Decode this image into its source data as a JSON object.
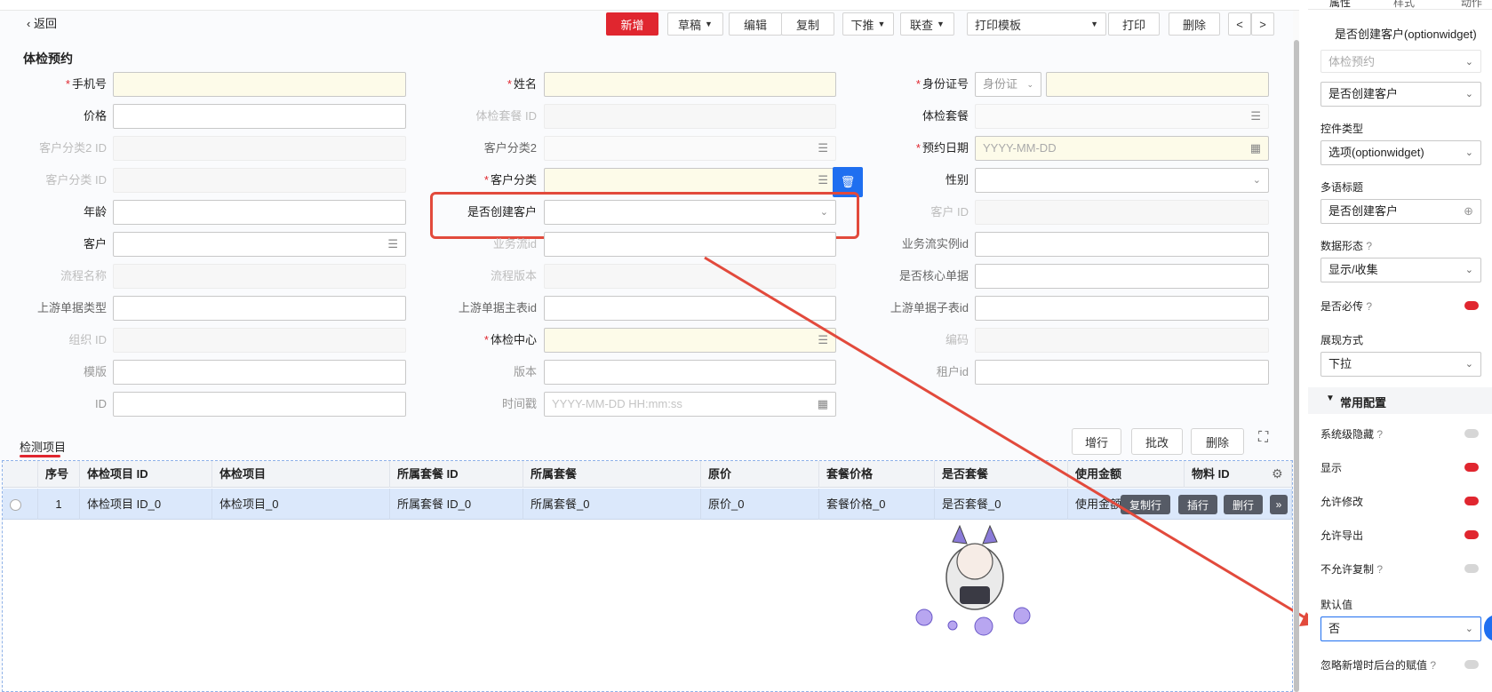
{
  "toolbar": {
    "back": "返回",
    "add": "新增",
    "draft": "草稿",
    "edit": "编辑",
    "copy": "复制",
    "push": "下推",
    "link": "联查",
    "print_template": "打印模板",
    "print": "打印",
    "delete": "删除",
    "prev": "<",
    "next": ">"
  },
  "form": {
    "title": "体检预约",
    "phone_label": "手机号",
    "name_label": "姓名",
    "idcard_label": "身份证号",
    "idcard_type": "身份证",
    "price_label": "价格",
    "pkg_id_label": "体检套餐 ID",
    "pkg_label": "体检套餐",
    "cust_cat2_id_label": "客户分类2 ID",
    "cust_cat2_label": "客户分类2",
    "appt_date_label": "预约日期",
    "appt_date_placeholder": "YYYY-MM-DD",
    "cust_cat_id_label": "客户分类 ID",
    "cust_cat_label": "客户分类",
    "gender_label": "性别",
    "age_label": "年龄",
    "create_cust_label": "是否创建客户",
    "cust_id_label": "客户 ID",
    "cust_label": "客户",
    "flow_id_label": "业务流id",
    "flow_inst_label": "业务流实例id",
    "proc_name_label": "流程名称",
    "proc_ver_label": "流程版本",
    "core_doc_label": "是否核心单据",
    "up_type_label": "上游单据类型",
    "up_main_label": "上游单据主表id",
    "up_sub_label": "上游单据子表id",
    "org_id_label": "组织 ID",
    "center_label": "体检中心",
    "code_label": "编码",
    "template_label": "模版",
    "version_label": "版本",
    "tenant_label": "租户id",
    "id_label": "ID",
    "timestamp_label": "时间戳",
    "timestamp_placeholder": "YYYY-MM-DD HH:mm:ss"
  },
  "subtable": {
    "tab": "检测项目",
    "add_row": "增行",
    "batch": "批改",
    "delete": "删除",
    "columns": [
      "序号",
      "体检项目 ID",
      "体检项目",
      "所属套餐 ID",
      "所属套餐",
      "原价",
      "套餐价格",
      "是否套餐",
      "使用金额",
      "物料 ID"
    ],
    "rows": [
      [
        "1",
        "体检项目 ID_0",
        "体检项目_0",
        "所属套餐 ID_0",
        "所属套餐_0",
        "原价_0",
        "套餐价格_0",
        "是否套餐_0",
        "使用金额"
      ]
    ],
    "row_actions": [
      "复制行",
      "插行",
      "删行"
    ]
  },
  "panel": {
    "tabs": [
      "属性",
      "样式",
      "动作"
    ],
    "field_title": "是否创建客户(optionwidget)",
    "entity": "体检预约",
    "field_select": "是否创建客户",
    "widget_type_label": "控件类型",
    "widget_type": "选项(optionwidget)",
    "i18n_label": "多语标题",
    "i18n_value": "是否创建客户",
    "data_form_label": "数据形态",
    "data_form": "显示/收集",
    "required_label": "是否必传",
    "display_label": "展现方式",
    "display_value": "下拉",
    "common_config": "常用配置",
    "sys_hidden_label": "系统级隐藏",
    "show_label": "显示",
    "allow_edit_label": "允许修改",
    "allow_export_label": "允许导出",
    "no_copy_label": "不允许复制",
    "default_label": "默认值",
    "default_value": "否",
    "ignore_label": "忽略新增时后台的赋值"
  },
  "colors": {
    "primary_red": "#e0262f",
    "annotation_red": "#e24a3c",
    "row_highlight": "#dbe8fb",
    "required_bg": "#fdfbe9"
  }
}
